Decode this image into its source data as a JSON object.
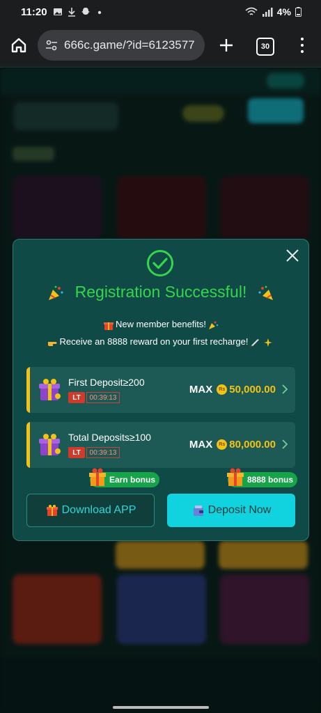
{
  "status_bar": {
    "time": "11:20",
    "battery": "4%"
  },
  "browser": {
    "url": "666c.game/?id=6123577",
    "tab_count": "30"
  },
  "modal": {
    "title": "Registration Successful!",
    "benefit_line1": "New member benefits!",
    "benefit_line2": "Receive an 8888 reward on your first recharge!",
    "tiers": [
      {
        "name": "First Deposit≥200",
        "lt": "LT",
        "timer": "00:39:13",
        "max_label": "MAX",
        "currency": "Rs",
        "amount": "50,000.00"
      },
      {
        "name": "Total Deposits≥100",
        "lt": "LT",
        "timer": "00:39:13",
        "max_label": "MAX",
        "currency": "Rs",
        "amount": "80,000.00"
      }
    ],
    "earn_bonus_badge": "Earn bonus",
    "deposit_bonus_badge": "8888 bonus",
    "download_label": "Download APP",
    "deposit_label": "Deposit Now"
  },
  "colors": {
    "accent_green": "#35d54c",
    "accent_cyan": "#11d3df",
    "gold": "#f2c316",
    "modal_bg": "#104a47"
  }
}
